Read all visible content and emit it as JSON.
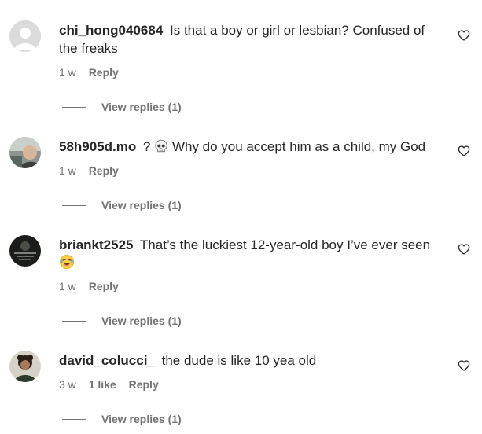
{
  "comments": [
    {
      "username": "chi_hong040684",
      "text": "Is that a boy or girl or lesbian? Confused of the freaks",
      "time": "1 w",
      "likes": "",
      "reply_label": "Reply",
      "view_replies": "View replies (1)",
      "avatar": "default-avatar"
    },
    {
      "username": "58h905d.mo",
      "text": "Why do you accept him as a child, my God",
      "prefix": "?",
      "emoji": "skull",
      "time": "1 w",
      "likes": "",
      "reply_label": "Reply",
      "view_replies": "View replies (1)",
      "avatar": "photo-avatar"
    },
    {
      "username": "briankt2525",
      "text": "That’s the luckiest 12-year-old boy I’ve ever seen",
      "emoji": "laughing-face",
      "time": "1 w",
      "likes": "",
      "reply_label": "Reply",
      "view_replies": "View replies (1)",
      "avatar": "dark-photo-avatar"
    },
    {
      "username": "david_colucci_",
      "text": "the dude is like 10 yea old",
      "time": "3 w",
      "likes": "1 like",
      "reply_label": "Reply",
      "view_replies": "View replies (1)",
      "avatar": "photo-avatar"
    }
  ],
  "colors": {
    "text": "#262626",
    "secondary": "#737373",
    "background": "#ffffff"
  }
}
